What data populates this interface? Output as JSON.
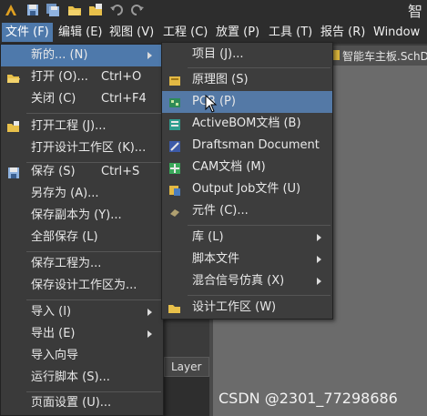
{
  "app": {
    "title_fragment": "智"
  },
  "toolbar": {
    "icons": [
      "app-logo-icon",
      "save-icon",
      "save-all-icon",
      "open-icon",
      "open-project-icon",
      "undo-icon",
      "redo-icon"
    ]
  },
  "menubar": {
    "items": [
      "文件 (F)",
      "编辑 (E)",
      "视图 (V)",
      "工程 (C)",
      "放置 (P)",
      "工具 (T)",
      "报告 (R)",
      "Window"
    ]
  },
  "document_tab": {
    "label": "智能车主板.SchDoc"
  },
  "panel": {
    "tab_label": "Layer"
  },
  "watermark": "CSDN @2301_77298686",
  "file_menu": {
    "items": [
      {
        "label": "新的... (N)",
        "shortcut": "",
        "submenu": true
      },
      {
        "label": "打开 (O)...",
        "shortcut": "Ctrl+O",
        "submenu": false
      },
      {
        "label": "关闭 (C)",
        "shortcut": "Ctrl+F4",
        "submenu": false
      },
      {
        "label": "打开工程 (J)...",
        "shortcut": "",
        "submenu": false
      },
      {
        "label": "打开设计工作区 (K)...",
        "shortcut": "",
        "submenu": false
      },
      {
        "label": "保存 (S)",
        "shortcut": "Ctrl+S",
        "submenu": false
      },
      {
        "label": "另存为 (A)...",
        "shortcut": "",
        "submenu": false
      },
      {
        "label": "保存副本为 (Y)...",
        "shortcut": "",
        "submenu": false
      },
      {
        "label": "全部保存 (L)",
        "shortcut": "",
        "submenu": false
      },
      {
        "label": "保存工程为...",
        "shortcut": "",
        "submenu": false
      },
      {
        "label": "保存设计工作区为...",
        "shortcut": "",
        "submenu": false
      },
      {
        "label": "导入 (I)",
        "shortcut": "",
        "submenu": true
      },
      {
        "label": "导出 (E)",
        "shortcut": "",
        "submenu": true
      },
      {
        "label": "导入向导",
        "shortcut": "",
        "submenu": false
      },
      {
        "label": "运行脚本 (S)...",
        "shortcut": "",
        "submenu": false
      },
      {
        "label": "页面设置 (U)...",
        "shortcut": "",
        "submenu": false
      }
    ]
  },
  "new_menu": {
    "items": [
      {
        "label": "项目 (J)...",
        "submenu": false
      },
      {
        "label": "原理图 (S)",
        "submenu": false
      },
      {
        "label": "PCB (P)",
        "submenu": false
      },
      {
        "label": "ActiveBOM文档 (B)",
        "submenu": false
      },
      {
        "label": "Draftsman Document",
        "submenu": false
      },
      {
        "label": "CAM文档 (M)",
        "submenu": false
      },
      {
        "label": "Output Job文件 (U)",
        "submenu": false
      },
      {
        "label": "元件 (C)...",
        "submenu": false
      },
      {
        "label": "库 (L)",
        "submenu": true
      },
      {
        "label": "脚本文件",
        "submenu": true
      },
      {
        "label": "混合信号仿真 (X)",
        "submenu": true
      },
      {
        "label": "设计工作区 (W)",
        "submenu": false
      }
    ]
  },
  "colors": {
    "menu_highlight": "#4e79ab",
    "menu_background": "#3a3a3a",
    "bar_background": "#2d2d2d",
    "canvas": "#6b6b6b"
  }
}
